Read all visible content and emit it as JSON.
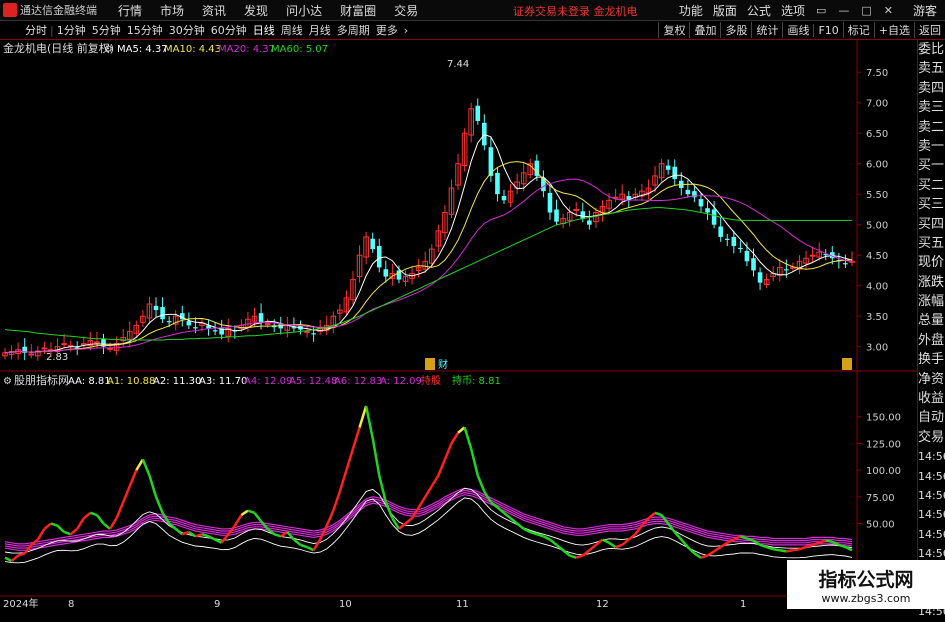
{
  "app": {
    "title": "通达信金融终端",
    "notice": "证券交易未登录 金龙机电",
    "guest": "游客"
  },
  "menu": [
    "行情",
    "市场",
    "资讯",
    "发现",
    "问小达",
    "财富圈",
    "交易"
  ],
  "right_menu": [
    "功能",
    "版面",
    "公式",
    "选项"
  ],
  "window_buttons": [
    "▭",
    "—",
    "□",
    "✕"
  ],
  "periods": [
    {
      "label": "分时",
      "active": false
    },
    {
      "label": "1分钟",
      "active": false
    },
    {
      "label": "5分钟",
      "active": false
    },
    {
      "label": "15分钟",
      "active": false
    },
    {
      "label": "30分钟",
      "active": false
    },
    {
      "label": "60分钟",
      "active": false
    },
    {
      "label": "日线",
      "active": true
    },
    {
      "label": "周线",
      "active": false
    },
    {
      "label": "月线",
      "active": false
    },
    {
      "label": "多周期",
      "active": false
    },
    {
      "label": "更多",
      "active": false
    }
  ],
  "tools": [
    "复权",
    "叠加",
    "多股",
    "统计",
    "画线",
    "F10",
    "标记",
    "+自选",
    "返回"
  ],
  "main_legend": {
    "stock": "金龙机电(日线 前复权)",
    "ma": [
      {
        "label": "MA5: 4.37",
        "color": "#ffffff"
      },
      {
        "label": "MA10: 4.43",
        "color": "#f5e642"
      },
      {
        "label": "MA20: 4.37",
        "color": "#d62bd6"
      },
      {
        "label": "MA60: 5.07",
        "color": "#22d422"
      }
    ]
  },
  "sub_legend": {
    "name": "股朋指标网",
    "items": [
      {
        "label": "AA: 8.81",
        "color": "#ffffff"
      },
      {
        "label": "A1: 10.88",
        "color": "#f5e642"
      },
      {
        "label": "A2: 11.30",
        "color": "#ffffff"
      },
      {
        "label": "A3: 11.70",
        "color": "#ffffff"
      },
      {
        "label": "A4: 12.09",
        "color": "#d62bd6"
      },
      {
        "label": "A5: 12.48",
        "color": "#d62bd6"
      },
      {
        "label": "A6: 12.83",
        "color": "#d62bd6"
      },
      {
        "label": "A: 12.09",
        "color": "#d62bd6"
      },
      {
        "label": "持股",
        "color": "#ff3030"
      },
      {
        "label": "持币: 8.81",
        "color": "#22d422"
      }
    ]
  },
  "annotations": {
    "high": "7.44",
    "low": "2.83",
    "event1": "财",
    "event2": "财"
  },
  "x_labels": [
    "2024年",
    "8",
    "9",
    "10",
    "11",
    "12",
    "1"
  ],
  "sidebar": [
    "委比",
    "卖五",
    "卖四",
    "卖三",
    "卖二",
    "卖一",
    "买一",
    "买二",
    "买三",
    "买四",
    "买五",
    "现价",
    "涨跌",
    "涨幅",
    "总量",
    "外盘",
    "换手",
    "净资",
    "收益",
    "自动",
    "交易",
    "14:56",
    "14:56",
    "14:56",
    "14:56",
    "14:56",
    "14:56",
    "14:56",
    "14:56",
    "14:56"
  ],
  "watermark": {
    "line1": "指标公式网",
    "line2": "www.zbgs3.com"
  },
  "colors": {
    "up": "#ff3232",
    "down": "#54ffff",
    "ma5": "#ffffff",
    "ma10": "#f5e642",
    "ma20": "#d62bd6",
    "ma60": "#22d422"
  },
  "chart_data": [
    {
      "type": "candlestick",
      "title": "金龙机电(日线 前复权)",
      "ylim": [
        2.7,
        7.7
      ],
      "y_ticks": [
        3.0,
        3.5,
        4.0,
        4.5,
        5.0,
        5.5,
        6.0,
        6.5,
        7.0,
        7.5
      ],
      "close": [
        2.9,
        2.92,
        2.95,
        2.9,
        2.88,
        2.93,
        2.98,
        2.95,
        3.0,
        3.05,
        3.02,
        2.98,
        3.05,
        3.1,
        3.08,
        3.0,
        2.97,
        3.05,
        3.15,
        3.25,
        3.35,
        3.5,
        3.7,
        3.6,
        3.45,
        3.4,
        3.5,
        3.45,
        3.35,
        3.3,
        3.38,
        3.3,
        3.25,
        3.2,
        3.3,
        3.25,
        3.35,
        3.45,
        3.5,
        3.4,
        3.38,
        3.32,
        3.3,
        3.35,
        3.3,
        3.28,
        3.25,
        3.2,
        3.3,
        3.35,
        3.5,
        3.6,
        3.8,
        4.1,
        4.5,
        4.8,
        4.6,
        4.3,
        4.15,
        4.2,
        4.1,
        4.15,
        4.2,
        4.3,
        4.4,
        4.6,
        4.9,
        5.2,
        5.6,
        6.0,
        6.5,
        6.9,
        6.7,
        6.3,
        5.8,
        5.5,
        5.4,
        5.55,
        5.7,
        5.85,
        6.0,
        5.8,
        5.55,
        5.2,
        5.05,
        5.1,
        5.2,
        5.25,
        5.1,
        5.0,
        5.2,
        5.3,
        5.4,
        5.45,
        5.5,
        5.4,
        5.5,
        5.55,
        5.6,
        5.8,
        6.0,
        5.9,
        5.75,
        5.6,
        5.5,
        5.45,
        5.3,
        5.2,
        5.0,
        4.8,
        4.75,
        4.65,
        4.6,
        4.4,
        4.25,
        4.05,
        4.1,
        4.2,
        4.3,
        4.25,
        4.3,
        4.4,
        4.45,
        4.5,
        4.55,
        4.5,
        4.45,
        4.4,
        4.35,
        4.4
      ],
      "ma60": [
        3.28,
        3.27,
        3.26,
        3.25,
        3.24,
        3.22,
        3.21,
        3.2,
        3.19,
        3.18,
        3.17,
        3.16,
        3.15,
        3.14,
        3.13,
        3.13,
        3.12,
        3.12,
        3.11,
        3.11,
        3.11,
        3.11,
        3.11,
        3.11,
        3.11,
        3.12,
        3.12,
        3.12,
        3.13,
        3.13,
        3.14,
        3.14,
        3.15,
        3.15,
        3.16,
        3.16,
        3.17,
        3.18,
        3.18,
        3.19,
        3.2,
        3.21,
        3.22,
        3.23,
        3.24,
        3.25,
        3.26,
        3.28,
        3.3,
        3.32,
        3.35,
        3.38,
        3.42,
        3.46,
        3.5,
        3.55,
        3.6,
        3.65,
        3.7,
        3.75,
        3.8,
        3.85,
        3.9,
        3.95,
        4.0,
        4.05,
        4.1,
        4.15,
        4.2,
        4.25,
        4.3,
        4.35,
        4.4,
        4.45,
        4.5,
        4.55,
        4.6,
        4.65,
        4.7,
        4.75,
        4.8,
        4.85,
        4.9,
        4.95,
        5.0,
        5.02,
        5.05,
        5.08,
        5.1,
        5.12,
        5.14,
        5.16,
        5.18,
        5.2,
        5.22,
        5.24,
        5.25,
        5.26,
        5.27,
        5.28,
        5.28,
        5.27,
        5.26,
        5.25,
        5.24,
        5.22,
        5.2,
        5.18,
        5.15,
        5.12,
        5.1,
        5.08,
        5.07,
        5.07,
        5.07,
        5.07,
        5.07,
        5.07,
        5.07,
        5.07,
        5.07,
        5.07,
        5.07,
        5.07,
        5.07,
        5.07,
        5.07,
        5.07,
        5.07,
        5.07
      ]
    },
    {
      "type": "line",
      "title": "股朋指标网",
      "ylim": [
        -15,
        175
      ],
      "y_ticks": [
        50,
        75,
        100,
        125,
        150
      ],
      "series": [
        {
          "name": "持股",
          "color": "#ff3232",
          "values": [
            18,
            15,
            20,
            22,
            30,
            35,
            45,
            50,
            48,
            42,
            40,
            45,
            55,
            60,
            58,
            50,
            45,
            55,
            70,
            85,
            100,
            110,
            95,
            75,
            60,
            50,
            45,
            40,
            42,
            38,
            40,
            38,
            35,
            32,
            40,
            48,
            58,
            62,
            60,
            52,
            45,
            40,
            38,
            42,
            35,
            30,
            28,
            25,
            35,
            48,
            62,
            80,
            100,
            120,
            140,
            160,
            130,
            95,
            70,
            55,
            45,
            50,
            55,
            65,
            75,
            85,
            95,
            110,
            125,
            135,
            140,
            120,
            95,
            80,
            70,
            65,
            60,
            55,
            50,
            45,
            42,
            40,
            38,
            35,
            30,
            25,
            20,
            18,
            20,
            25,
            30,
            35,
            32,
            28,
            30,
            35,
            40,
            48,
            55,
            60,
            58,
            50,
            42,
            35,
            28,
            22,
            18,
            20,
            24,
            28,
            32,
            35,
            38,
            36,
            34,
            30,
            28,
            26,
            25,
            24,
            25,
            26,
            28,
            30,
            32,
            34,
            33,
            30,
            28,
            25
          ]
        },
        {
          "name": "A",
          "color": "#d62bd6",
          "values": [
            30,
            29,
            28,
            28,
            29,
            30,
            31,
            32,
            33,
            34,
            35,
            36,
            37,
            38,
            39,
            40,
            40,
            41,
            43,
            45,
            48,
            52,
            55,
            56,
            55,
            53,
            52,
            50,
            48,
            46,
            45,
            44,
            43,
            42,
            42,
            43,
            45,
            47,
            48,
            48,
            47,
            46,
            45,
            44,
            43,
            42,
            41,
            40,
            41,
            43,
            46,
            50,
            55,
            60,
            65,
            70,
            72,
            71,
            69,
            66,
            63,
            61,
            60,
            60,
            62,
            65,
            68,
            72,
            75,
            78,
            80,
            79,
            77,
            74,
            71,
            68,
            65,
            62,
            59,
            56,
            54,
            52,
            50,
            48,
            46,
            44,
            43,
            42,
            42,
            43,
            44,
            45,
            46,
            46,
            46,
            47,
            48,
            50,
            52,
            53,
            53,
            52,
            50,
            48,
            46,
            44,
            42,
            40,
            39,
            38,
            37,
            36,
            36,
            35,
            35,
            34,
            34,
            33,
            33,
            33,
            33,
            33,
            33,
            34,
            34,
            34,
            34,
            33,
            33,
            32
          ]
        }
      ]
    }
  ]
}
